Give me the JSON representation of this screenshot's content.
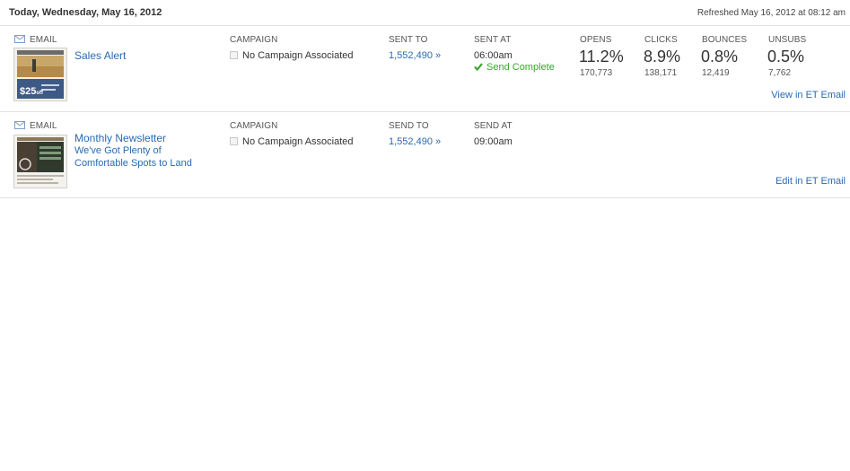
{
  "header": {
    "date": "Today, Wednesday, May 16, 2012",
    "refreshed": "Refreshed May 16, 2012 at 08:12 am"
  },
  "sends": [
    {
      "type_label": "EMAIL",
      "name": "Sales Alert",
      "campaign_label": "CAMPAIGN",
      "campaign_value": "No Campaign Associated",
      "to_label": "SENT TO",
      "to_value": "1,552,490 »",
      "at_label": "SENT AT",
      "at_value": "06:00am",
      "status": "Send Complete",
      "thumb_badge": "$25",
      "thumb_badge_suffix": "off",
      "stats": [
        {
          "label": "OPENS",
          "pct": "11.2%",
          "count": "170,773"
        },
        {
          "label": "CLICKS",
          "pct": "8.9%",
          "count": "138,171"
        },
        {
          "label": "BOUNCES",
          "pct": "0.8%",
          "count": "12,419"
        },
        {
          "label": "UNSUBS",
          "pct": "0.5%",
          "count": "7,762"
        }
      ],
      "action": "View in ET Email"
    },
    {
      "type_label": "EMAIL",
      "name_line1": "Monthly Newsletter",
      "name_line2": "We've Got Plenty of",
      "name_line3": "Comfortable Spots to Land",
      "campaign_label": "CAMPAIGN",
      "campaign_value": "No Campaign Associated",
      "to_label": "SEND TO",
      "to_value": "1,552,490 »",
      "at_label": "SEND AT",
      "at_value": "09:00am",
      "action": "Edit in ET Email"
    }
  ],
  "colors": {
    "link": "#2a6ab3",
    "success": "#3aa52d",
    "divider": "#e2e2e2"
  }
}
